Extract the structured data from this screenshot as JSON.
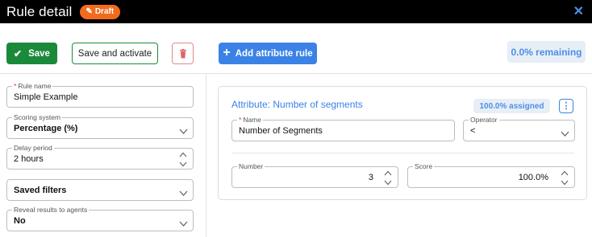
{
  "header": {
    "title": "Rule detail",
    "badge": "Draft",
    "badge_icon": "pencil-icon",
    "close_icon": "close-icon"
  },
  "toolbar": {
    "save_label": "Save",
    "save_activate_label": "Save and activate",
    "delete_icon": "trash-icon",
    "add_rule_label": "Add attribute rule",
    "remaining": "0.0% remaining"
  },
  "left": {
    "rule_name": {
      "label": "Rule name",
      "value": "Simple Example"
    },
    "scoring_system": {
      "label": "Scoring system",
      "value": "Percentage (%)"
    },
    "delay_period": {
      "label": "Delay period",
      "value": "2 hours"
    },
    "saved_filters": {
      "value": "Saved filters"
    },
    "reveal_results": {
      "label": "Reveal results to agents",
      "value": "No"
    }
  },
  "card": {
    "title": "Attribute: Number of segments",
    "assigned": "100.0% assigned",
    "name_field": {
      "label": "Name",
      "value": "Number of Segments"
    },
    "operator_field": {
      "label": "Operator",
      "value": "<"
    },
    "number_field": {
      "label": "Number",
      "value": "3"
    },
    "score_field": {
      "label": "Score",
      "value": "100.0%"
    }
  },
  "colors": {
    "header_bg": "#000000",
    "draft_badge": "#f26b1d",
    "save_green": "#1a8a3a",
    "primary_blue": "#3b82e6",
    "delete_red": "#e06464"
  }
}
